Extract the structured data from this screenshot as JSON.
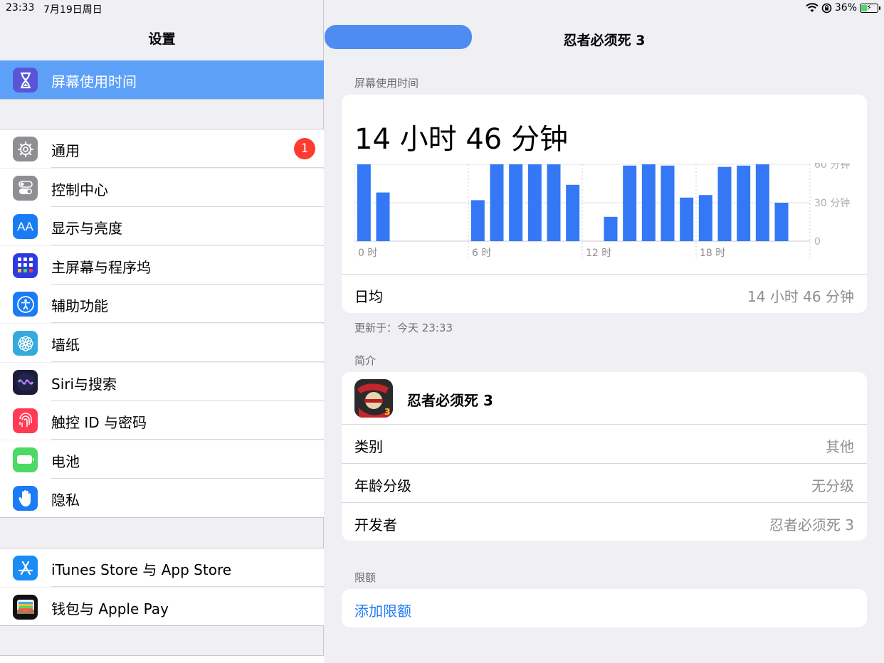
{
  "status": {
    "time": "23:33",
    "date": "7月19日周日",
    "battery": "36%",
    "battery_level": 0.36
  },
  "sidebar": {
    "title": "设置",
    "selected": {
      "label": "屏幕使用时间",
      "icon": "hourglass-icon",
      "color": "#5856d6"
    },
    "group1": [
      {
        "label": "通用",
        "icon": "gear-icon",
        "color": "#8e8e93",
        "badge": "1"
      },
      {
        "label": "控制中心",
        "icon": "toggles-icon",
        "color": "#8e8e93"
      },
      {
        "label": "显示与亮度",
        "icon": "text-size-icon",
        "color": "#1a7cf4",
        "glyph": "AA"
      },
      {
        "label": "主屏幕与程序坞",
        "icon": "home-grid-icon",
        "color": "#2d3be0"
      },
      {
        "label": "辅助功能",
        "icon": "accessibility-icon",
        "color": "#1a7cf4"
      },
      {
        "label": "墙纸",
        "icon": "flower-icon",
        "color": "#35aadc"
      },
      {
        "label": "Siri与搜索",
        "icon": "siri-icon",
        "color": "#1c1c3a"
      },
      {
        "label": "触控 ID 与密码",
        "icon": "fingerprint-icon",
        "color": "#ff3b55"
      },
      {
        "label": "电池",
        "icon": "battery-icon",
        "color": "#4cd964"
      },
      {
        "label": "隐私",
        "icon": "hand-icon",
        "color": "#1a7cf4"
      }
    ],
    "group2": [
      {
        "label": "iTunes Store 与 App Store",
        "icon": "app-store-icon",
        "color": "#1a8cf4"
      },
      {
        "label": "钱包与 Apple Pay",
        "icon": "wallet-icon",
        "color": "#111111"
      }
    ]
  },
  "detail": {
    "title": "忍者必须死 3",
    "section_usage": "屏幕使用时间",
    "total": "14 小时 46 分钟",
    "daily_avg_label": "日均",
    "daily_avg_value": "14 小时 46 分钟",
    "updated": "更新于：今天 23:33",
    "section_info": "简介",
    "app_name": "忍者必须死 3",
    "info_rows": [
      {
        "key": "类别",
        "value": "其他"
      },
      {
        "key": "年龄分级",
        "value": "无分级"
      },
      {
        "key": "开发者",
        "value": "忍者必须死 3"
      }
    ],
    "section_limit": "限额",
    "add_limit": "添加限额"
  },
  "chart_data": {
    "type": "bar",
    "x": [
      0,
      1,
      2,
      3,
      4,
      5,
      6,
      7,
      8,
      9,
      10,
      11,
      12,
      13,
      14,
      15,
      16,
      17,
      18,
      19,
      20,
      21,
      22,
      23
    ],
    "values": [
      60,
      38,
      0,
      0,
      0,
      0,
      32,
      60,
      60,
      60,
      60,
      44,
      0,
      19,
      59,
      60,
      59,
      34,
      36,
      58,
      59,
      60,
      30,
      0
    ],
    "x_tick_labels": [
      "0 时",
      "6 时",
      "12 时",
      "18 时"
    ],
    "y_tick_labels": [
      "60 分钟",
      "30 分钟",
      "0"
    ],
    "ylim": [
      0,
      60
    ],
    "bar_color": "#3478f6"
  }
}
